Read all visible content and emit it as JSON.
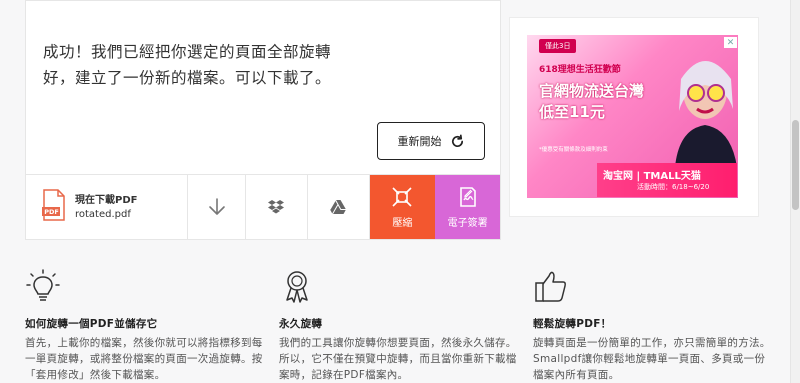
{
  "result": {
    "message": "成功！我們已經把你選定的頁面全部旋轉好，建立了一份新的檔案。可以下載了。",
    "restart_label": "重新開始"
  },
  "download": {
    "title": "現在下載PDF",
    "filename": "rotated.pdf"
  },
  "actions": {
    "compress_label": "壓縮",
    "esign_label": "電子簽署"
  },
  "ad": {
    "badge": "僅此3日",
    "subtitle": "618理想生活狂歡節",
    "headline1": "官網物流送台灣",
    "headline2": "低至11元",
    "note": "*優惠受有關條款及細則約束",
    "brand": "淘宝网 | TMALL天猫",
    "date": "活動時間：6/18~6/20",
    "close": "✕"
  },
  "features": [
    {
      "icon": "lightbulb-icon",
      "title": "如何旋轉一個PDF並儲存它",
      "body": "首先，上載你的檔案，然後你就可以將指標移到每一單頁旋轉，或將整份檔案的頁面一次過旋轉。按「套用修改」然後下載檔案。"
    },
    {
      "icon": "award-ribbon-icon",
      "title": "永久旋轉",
      "body": "我們的工具讓你旋轉你想要頁面，然後永久儲存。所以，它不僅在預覽中旋轉，而且當你重新下載檔案時，記錄在PDF檔案內。"
    },
    {
      "icon": "thumbs-up-icon",
      "title": "輕鬆旋轉PDF！",
      "body": "旋轉頁面是一份簡單的工作，亦只需簡單的方法。Smallpdf讓你輕鬆地旋轉單一頁面、多頁或一份檔案內所有頁面。"
    }
  ]
}
